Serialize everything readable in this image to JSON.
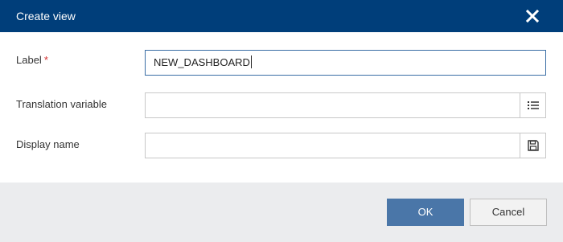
{
  "dialog": {
    "title": "Create view",
    "close_icon": "close-icon"
  },
  "form": {
    "label": {
      "text": "Label",
      "required_mark": "*",
      "value": "NEW_DASHBOARD"
    },
    "translation_variable": {
      "text": "Translation variable",
      "value": "",
      "button_icon": "list-icon"
    },
    "display_name": {
      "text": "Display name",
      "value": "",
      "button_icon": "save-icon"
    }
  },
  "footer": {
    "ok_label": "OK",
    "cancel_label": "Cancel"
  },
  "colors": {
    "titlebar": "#003e7a",
    "primary_button": "#4a76a8",
    "required": "#d32f2f",
    "footer": "#ebecee"
  }
}
